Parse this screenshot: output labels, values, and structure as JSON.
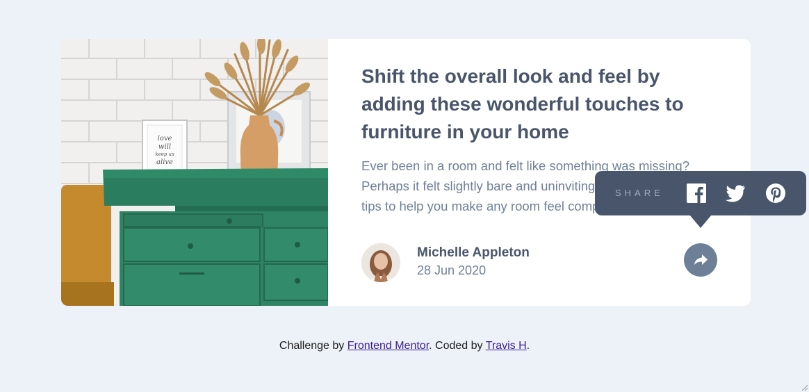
{
  "card": {
    "title": "Shift the overall look and feel by adding these wonderful touches to furniture in your home",
    "description": "Ever been in a room and felt like something was missing? Perhaps it felt slightly bare and uninviting. I’ve got some simple tips to help you make any room feel complete.",
    "author_name": "Michelle Appleton",
    "date": "28 Jun 2020",
    "frame_text": [
      "love",
      "will",
      "keep us",
      "alive"
    ]
  },
  "share": {
    "label": "SHARE",
    "icons": [
      "share-arrow-icon",
      "facebook-icon",
      "twitter-icon",
      "pinterest-icon"
    ]
  },
  "footer": {
    "prefix": "Challenge by ",
    "link1": "Frontend Mentor",
    "middle": ". Coded by ",
    "link2": "Travis H",
    "suffix": "."
  },
  "colors": {
    "background": "#ecf2f8",
    "heading": "#48556a",
    "body_text": "#6e8098",
    "tooltip": "#48556a",
    "share_label": "#9eafc2",
    "link": "#3e1c96"
  }
}
